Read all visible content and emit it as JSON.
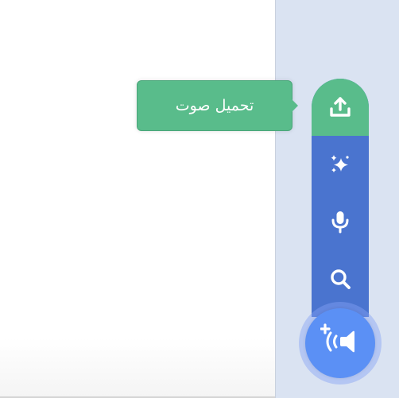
{
  "tooltip": {
    "text": "تحميل صوت"
  },
  "menu": {
    "items": [
      {
        "name": "upload",
        "icon": "upload-icon",
        "color": "#59bc8b",
        "active": true
      },
      {
        "name": "surprise",
        "icon": "sparkles-icon",
        "color": "#4a74cf"
      },
      {
        "name": "record",
        "icon": "microphone-icon",
        "color": "#4a74cf"
      },
      {
        "name": "choose",
        "icon": "search-icon",
        "color": "#4a74cf"
      }
    ],
    "main_button": {
      "icon": "add-sound-icon",
      "color": "#5b90f5"
    }
  },
  "colors": {
    "side_panel": "#dae3f2",
    "accent_green": "#59bc8b",
    "menu_blue": "#4a74cf"
  }
}
